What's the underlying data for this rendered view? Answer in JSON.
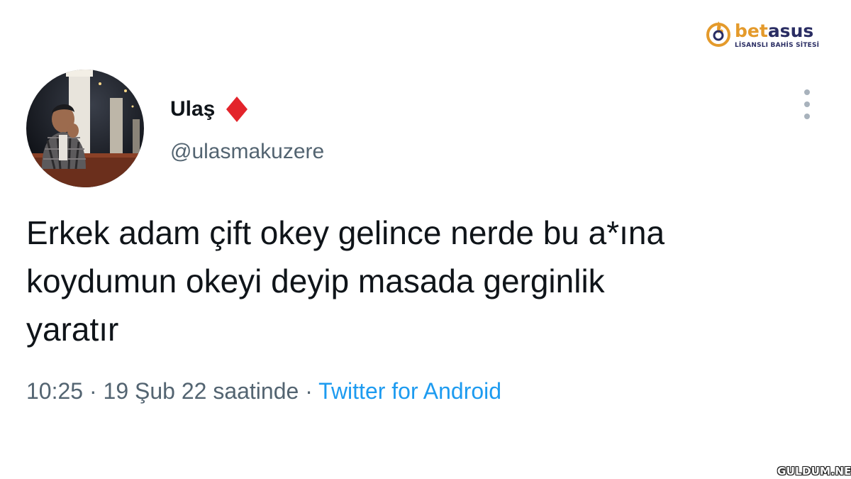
{
  "brand": {
    "name_part_a": "bet",
    "name_part_b": "asus",
    "tagline": "LİSANSLI BAHİS SİTESİ",
    "icon": "flame-ring-icon",
    "colors": {
      "accent": "#e49a2b",
      "dark": "#2a2d63"
    }
  },
  "tweet": {
    "author": {
      "display_name": "Ulaş",
      "badge_icon": "red-diamond-icon",
      "handle": "@ulasmakuzere",
      "avatar_icon": "profile-photo"
    },
    "menu_icon": "more-vertical-icon",
    "text_lines": [
      "Erkek adam çift okey gelince nerde bu a*ına",
      "koydumun okeyi deyip masada gerginlik",
      "yaratır"
    ],
    "meta": {
      "time": "10:25",
      "separator": "·",
      "date": "19 Şub 22 saatinde",
      "source": "Twitter for Android"
    }
  },
  "watermark": {
    "site": "GULDUM.NET"
  },
  "colors": {
    "text": "#0f1419",
    "secondary": "#536471",
    "link": "#1d9bf0",
    "diamond": "#e3242b"
  }
}
